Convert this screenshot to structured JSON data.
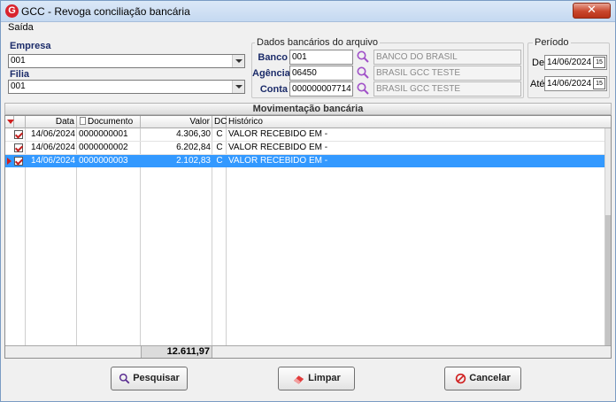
{
  "window": {
    "title": "GCC - Revoga conciliação bancária",
    "logo_letter": "G",
    "close_glyph": "✕"
  },
  "menu": {
    "items": [
      "Saída"
    ]
  },
  "empresa": {
    "label": "Empresa",
    "value": "001"
  },
  "filial": {
    "label": "Filia",
    "value": "001"
  },
  "dados_bancarios": {
    "legend": "Dados bancários do arquivo",
    "banco": {
      "label": "Banco",
      "value": "001",
      "description": "BANCO DO BRASIL"
    },
    "agencia": {
      "label": "Agência",
      "value": "06450",
      "description": "BRASIL GCC TESTE"
    },
    "conta": {
      "label": "Conta",
      "value": "000000007714",
      "description": "BRASIL GCC TESTE"
    },
    "lookup_icon": "search-icon"
  },
  "periodo": {
    "legend": "Período",
    "de": {
      "label": "De",
      "value": "14/06/2024"
    },
    "ate": {
      "label": "Até",
      "value": "14/06/2024"
    },
    "calendar_glyph": "15"
  },
  "movimentacao": {
    "title": "Movimentação bancária",
    "columns": [
      "Data",
      "Documento",
      "Valor",
      "DC",
      "Histórico"
    ],
    "rows": [
      {
        "checked": true,
        "data": "14/06/2024",
        "documento": "0000000001",
        "valor": "4.306,30",
        "dc": "C",
        "historico": "VALOR RECEBIDO EM -",
        "selected": false
      },
      {
        "checked": true,
        "data": "14/06/2024",
        "documento": "0000000002",
        "valor": "6.202,84",
        "dc": "C",
        "historico": "VALOR RECEBIDO EM -",
        "selected": false
      },
      {
        "checked": true,
        "data": "14/06/2024",
        "documento": "0000000003",
        "valor": "2.102,83",
        "dc": "C",
        "historico": "VALOR RECEBIDO EM -",
        "selected": true
      }
    ],
    "total": "12.611,97"
  },
  "buttons": {
    "pesquisar": "Pesquisar",
    "limpar": "Limpar",
    "cancelar": "Cancelar"
  },
  "colors": {
    "selection": "#3399ff",
    "label_blue": "#1c2c6a",
    "accent_red": "#d01f1f"
  }
}
